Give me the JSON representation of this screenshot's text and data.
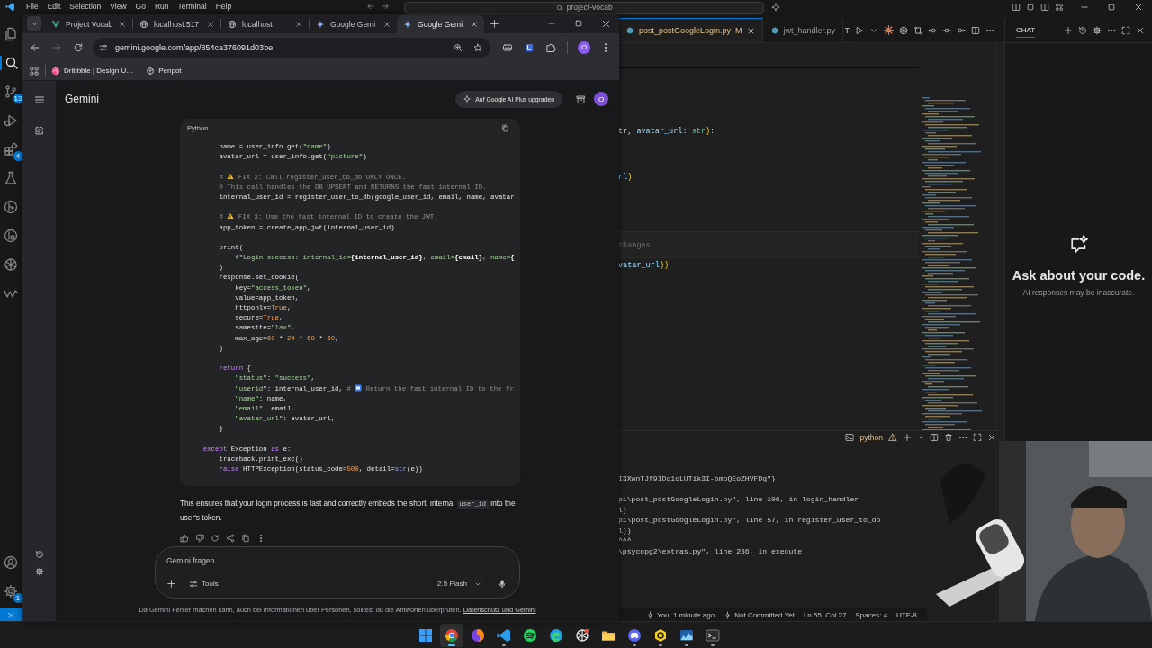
{
  "vscode": {
    "menu": [
      "File",
      "Edit",
      "Selection",
      "View",
      "Go",
      "Run",
      "Terminal",
      "Help"
    ],
    "command_center": "project-vocab",
    "activity_bar": [
      {
        "selected": false
      },
      {
        "selected": true
      },
      {
        "selected": false,
        "badge": "13"
      },
      {
        "selected": false
      },
      {
        "selected": false,
        "badge": "4"
      },
      {
        "selected": false
      },
      {
        "selected": false
      },
      {
        "selected": false
      },
      {
        "selected": false
      },
      {
        "selected": false
      }
    ],
    "activity_bar_bottom": [
      {
        "selected": false
      },
      {
        "selected": false,
        "badge": "1"
      }
    ],
    "editor_tabs": [
      {
        "label": "post_postGoogleLogin.py",
        "status": "M",
        "selected": true
      },
      {
        "label": "jwt_handler.py",
        "selected": false
      }
    ],
    "editor_toolbar_letter": "T",
    "editor_lines": [
      {
        "kind": "code",
        "segments": [
          {
            "kind": "plain",
            "text": "tr, "
          },
          {
            "kind": "param",
            "text": "avatar_url"
          },
          {
            "kind": "plain",
            "text": ": "
          },
          {
            "kind": "type",
            "text": "str"
          },
          {
            "kind": "bracket",
            "text": "):"
          }
        ]
      },
      {
        "kind": "blank"
      },
      {
        "kind": "blank"
      },
      {
        "kind": "code",
        "segments": [
          {
            "kind": "param",
            "text": "rl"
          },
          {
            "kind": "bracket",
            "text": ")"
          }
        ]
      },
      {
        "kind": "blank"
      },
      {
        "kind": "blank"
      },
      {
        "kind": "blank"
      },
      {
        "kind": "hint",
        "text": "changes"
      },
      {
        "kind": "code",
        "segments": [
          {
            "kind": "param",
            "text": "vatar_url"
          },
          {
            "kind": "bracket",
            "text": "))"
          }
        ]
      }
    ],
    "terminal": {
      "profile": "python",
      "lines": [
        {
          "kind": "output",
          "text": "I3XwnTJf9IDq1oLUTik3I-bmbQEoZHVFDg\"}"
        },
        {
          "kind": "blank"
        },
        {
          "kind": "output",
          "text": "pi\\post_postGoogleLogin.py\", line 106, in login_handler"
        },
        {
          "kind": "output",
          "text": "l)"
        },
        {
          "kind": "output",
          "text": "pi\\post_postGoogleLogin.py\", line 57, in register_user_to_db"
        },
        {
          "kind": "output",
          "text": "l))"
        },
        {
          "kind": "output",
          "text": "^^^"
        },
        {
          "kind": "output",
          "text": "\\psycopg2\\extras.py\", line 236, in execute"
        }
      ]
    },
    "chat": {
      "tabs": [
        {
          "label": "CHAT",
          "selected": true
        }
      ],
      "heading": "Ask about your code.",
      "note": "AI responses may be inaccurate."
    },
    "status_bar": [
      {
        "kind": "commit",
        "text": "You, 1 minute ago"
      },
      {
        "kind": "commit",
        "text": "Not Committed Yet"
      },
      {
        "kind": "plain",
        "text": "Ln 55, Col 27"
      },
      {
        "kind": "plain",
        "text": "Spaces: 4"
      },
      {
        "kind": "plain",
        "text": "UTF-8"
      }
    ]
  },
  "browser": {
    "tabs": [
      {
        "label": "Project Vocab",
        "selected": false
      },
      {
        "label": "localhost:517",
        "selected": false
      },
      {
        "label": "localhost",
        "selected": false
      },
      {
        "label": "Google Gemi",
        "selected": false
      },
      {
        "label": "Google Gemi",
        "selected": true
      }
    ],
    "forward_disabled": true,
    "url": "gemini.google.com/app/854ca376091d03be",
    "profile": "O",
    "bookmarks": [
      {
        "label": "Dribbble | Design U…"
      },
      {
        "label": "Penpot"
      }
    ],
    "gemini": {
      "title": "Gemini",
      "upgrade_button": "Auf Google AI Plus upgraden",
      "avatar": "O",
      "code_block": {
        "language": "Python",
        "lines": [
          {
            "kind": "code",
            "segments": [
              {
                "kind": "plain",
                "text": "        name = user_info.get("
              },
              {
                "kind": "string",
                "text": "\"name\""
              },
              {
                "kind": "plain",
                "text": ")"
              }
            ]
          },
          {
            "kind": "code",
            "segments": [
              {
                "kind": "plain",
                "text": "        avatar_url = user_info.get("
              },
              {
                "kind": "string",
                "text": "\"picture\""
              },
              {
                "kind": "plain",
                "text": ")"
              }
            ]
          },
          {
            "kind": "blank"
          },
          {
            "kind": "code",
            "segments": [
              {
                "kind": "comment",
                "text": "        # "
              },
              {
                "kind": "warning-icon"
              },
              {
                "kind": "comment",
                "text": " FIX 2: Call register_user_to_db ONLY ONCE."
              }
            ]
          },
          {
            "kind": "code",
            "segments": [
              {
                "kind": "comment",
                "text": "        # This call handles the DB UPSERT and RETURNS the fast internal ID."
              }
            ]
          },
          {
            "kind": "code",
            "segments": [
              {
                "kind": "plain",
                "text": "        internal_user_id = register_user_to_db(google_user_id, email, name, avatar"
              }
            ]
          },
          {
            "kind": "blank"
          },
          {
            "kind": "code",
            "segments": [
              {
                "kind": "comment",
                "text": "        # "
              },
              {
                "kind": "warning-icon"
              },
              {
                "kind": "comment",
                "text": " FIX 3: Use the fast internal ID to create the JWT."
              }
            ]
          },
          {
            "kind": "code",
            "segments": [
              {
                "kind": "plain",
                "text": "        app_token = create_app_jwt(internal_user_id)"
              }
            ]
          },
          {
            "kind": "blank"
          },
          {
            "kind": "code",
            "segments": [
              {
                "kind": "plain",
                "text": "        print("
              }
            ]
          },
          {
            "kind": "code",
            "segments": [
              {
                "kind": "string",
                "text": "            f\"Login success: internal_id="
              },
              {
                "kind": "interp",
                "text": "{internal_user_id}"
              },
              {
                "kind": "string",
                "text": ", email="
              },
              {
                "kind": "interp",
                "text": "{email}"
              },
              {
                "kind": "string",
                "text": ", name="
              },
              {
                "kind": "interp",
                "text": "{"
              }
            ]
          },
          {
            "kind": "code",
            "segments": [
              {
                "kind": "plain",
                "text": "        )"
              }
            ]
          },
          {
            "kind": "code",
            "segments": [
              {
                "kind": "plain",
                "text": "        response.set_cookie("
              }
            ]
          },
          {
            "kind": "code",
            "segments": [
              {
                "kind": "plain",
                "text": "            key="
              },
              {
                "kind": "string",
                "text": "\"access_token\""
              },
              {
                "kind": "plain",
                "text": ","
              }
            ]
          },
          {
            "kind": "code",
            "segments": [
              {
                "kind": "plain",
                "text": "            value=app_token,"
              }
            ]
          },
          {
            "kind": "code",
            "segments": [
              {
                "kind": "plain",
                "text": "            httponly="
              },
              {
                "kind": "number",
                "text": "True"
              },
              {
                "kind": "plain",
                "text": ","
              }
            ]
          },
          {
            "kind": "code",
            "segments": [
              {
                "kind": "plain",
                "text": "            secure="
              },
              {
                "kind": "number",
                "text": "True"
              },
              {
                "kind": "plain",
                "text": ","
              }
            ]
          },
          {
            "kind": "code",
            "segments": [
              {
                "kind": "plain",
                "text": "            samesite="
              },
              {
                "kind": "string",
                "text": "\"lax\""
              },
              {
                "kind": "plain",
                "text": ","
              }
            ]
          },
          {
            "kind": "code",
            "segments": [
              {
                "kind": "plain",
                "text": "            max_age="
              },
              {
                "kind": "number",
                "text": "60"
              },
              {
                "kind": "plain",
                "text": " * "
              },
              {
                "kind": "number",
                "text": "24"
              },
              {
                "kind": "plain",
                "text": " * "
              },
              {
                "kind": "number",
                "text": "60"
              },
              {
                "kind": "plain",
                "text": " * "
              },
              {
                "kind": "number",
                "text": "60"
              },
              {
                "kind": "plain",
                "text": ","
              }
            ]
          },
          {
            "kind": "code",
            "segments": [
              {
                "kind": "plain",
                "text": "        )"
              }
            ]
          },
          {
            "kind": "blank"
          },
          {
            "kind": "code",
            "segments": [
              {
                "kind": "keyword",
                "text": "        return"
              },
              {
                "kind": "plain",
                "text": " {"
              }
            ]
          },
          {
            "kind": "code",
            "segments": [
              {
                "kind": "string",
                "text": "            \"status\""
              },
              {
                "kind": "plain",
                "text": ": "
              },
              {
                "kind": "string",
                "text": "\"success\""
              },
              {
                "kind": "plain",
                "text": ","
              }
            ]
          },
          {
            "kind": "code",
            "segments": [
              {
                "kind": "string",
                "text": "            \"userid\""
              },
              {
                "kind": "plain",
                "text": ": internal_user_id, "
              },
              {
                "kind": "comment",
                "text": "# "
              },
              {
                "kind": "square-icon"
              },
              {
                "kind": "comment",
                "text": " Return the fast internal ID to the fr"
              }
            ]
          },
          {
            "kind": "code",
            "segments": [
              {
                "kind": "string",
                "text": "            \"name\""
              },
              {
                "kind": "plain",
                "text": ": name,"
              }
            ]
          },
          {
            "kind": "code",
            "segments": [
              {
                "kind": "string",
                "text": "            \"email\""
              },
              {
                "kind": "plain",
                "text": ": email,"
              }
            ]
          },
          {
            "kind": "code",
            "segments": [
              {
                "kind": "string",
                "text": "            \"avatar_url\""
              },
              {
                "kind": "plain",
                "text": ": avatar_url,"
              }
            ]
          },
          {
            "kind": "code",
            "segments": [
              {
                "kind": "plain",
                "text": "        }"
              }
            ]
          },
          {
            "kind": "blank"
          },
          {
            "kind": "code",
            "segments": [
              {
                "kind": "keyword",
                "text": "    except"
              },
              {
                "kind": "plain",
                "text": " Exception "
              },
              {
                "kind": "keyword",
                "text": "as"
              },
              {
                "kind": "plain",
                "text": " e:"
              }
            ]
          },
          {
            "kind": "code",
            "segments": [
              {
                "kind": "plain",
                "text": "        traceback.print_exc()"
              }
            ]
          },
          {
            "kind": "code",
            "segments": [
              {
                "kind": "keyword",
                "text": "        raise"
              },
              {
                "kind": "plain",
                "text": " HTTPException(status_code="
              },
              {
                "kind": "number",
                "text": "500"
              },
              {
                "kind": "plain",
                "text": ", detail="
              },
              {
                "kind": "builtin",
                "text": "str"
              },
              {
                "kind": "plain",
                "text": "(e))"
              }
            ]
          }
        ]
      },
      "response": {
        "text_before": "This ensures that your login process is fast and correctly embeds the short, internal ",
        "code": "user_id",
        "text_after": " into the user's token."
      },
      "prompt": {
        "placeholder": "Gemini fragen",
        "tools_button": "Tools",
        "model": "2.5 Flash"
      },
      "disclaimer": {
        "text": "Da Gemini Fehler machen kann, auch bei Informationen über Personen, solltest du die Antworten überprüfen.",
        "link": "Datenschutz und Gemini"
      }
    }
  },
  "taskbar": [
    {
      "selected": false,
      "running": false
    },
    {
      "selected": true,
      "running": true
    },
    {
      "selected": false,
      "running": false
    },
    {
      "selected": false,
      "running": true
    },
    {
      "selected": false,
      "running": false
    },
    {
      "selected": false,
      "running": false
    },
    {
      "selected": false,
      "running": false
    },
    {
      "selected": false,
      "running": false
    },
    {
      "selected": false,
      "running": true
    },
    {
      "selected": false,
      "running": true
    },
    {
      "selected": false,
      "running": true
    },
    {
      "selected": false,
      "running": true
    }
  ]
}
